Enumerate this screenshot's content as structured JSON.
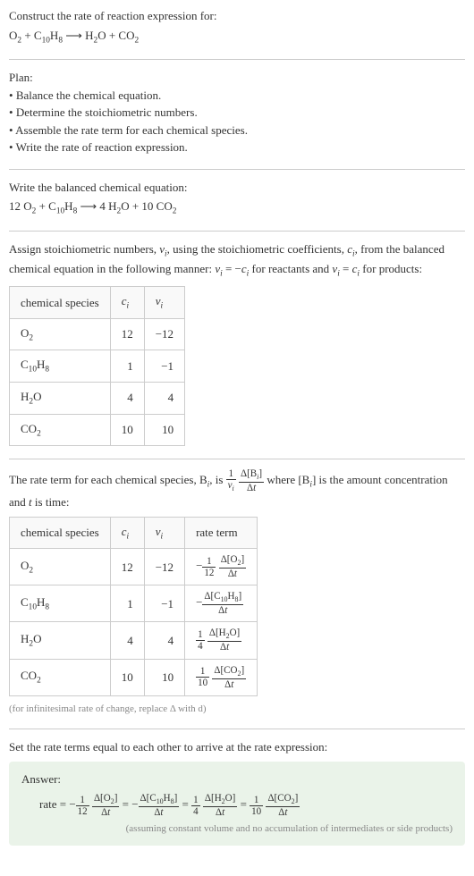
{
  "intro": {
    "title": "Construct the rate of reaction expression for:",
    "equation_html": "O<span class='sub'>2</span> + C<span class='sub'>10</span>H<span class='sub'>8</span> ⟶ H<span class='sub'>2</span>O + CO<span class='sub'>2</span>"
  },
  "plan": {
    "title": "Plan:",
    "items": [
      "Balance the chemical equation.",
      "Determine the stoichiometric numbers.",
      "Assemble the rate term for each chemical species.",
      "Write the rate of reaction expression."
    ]
  },
  "balanced": {
    "title": "Write the balanced chemical equation:",
    "equation_html": "12 O<span class='sub'>2</span> + C<span class='sub'>10</span>H<span class='sub'>8</span> ⟶ 4 H<span class='sub'>2</span>O + 10 CO<span class='sub'>2</span>"
  },
  "stoich_intro_html": "Assign stoichiometric numbers, <span class='ital'>ν<span class='sub'>i</span></span>, using the stoichiometric coefficients, <span class='ital'>c<span class='sub'>i</span></span>, from the balanced chemical equation in the following manner: <span class='ital'>ν<span class='sub'>i</span></span> = −<span class='ital'>c<span class='sub'>i</span></span> for reactants and <span class='ital'>ν<span class='sub'>i</span></span> = <span class='ital'>c<span class='sub'>i</span></span> for products:",
  "table1": {
    "headers": {
      "species": "chemical species",
      "ci_html": "<span class='ital'>c<span class='sub'>i</span></span>",
      "vi_html": "<span class='ital'>ν<span class='sub'>i</span></span>"
    },
    "rows": [
      {
        "species_html": "O<span class='sub'>2</span>",
        "ci": "12",
        "vi": "−12"
      },
      {
        "species_html": "C<span class='sub'>10</span>H<span class='sub'>8</span>",
        "ci": "1",
        "vi": "−1"
      },
      {
        "species_html": "H<span class='sub'>2</span>O",
        "ci": "4",
        "vi": "4"
      },
      {
        "species_html": "CO<span class='sub'>2</span>",
        "ci": "10",
        "vi": "10"
      }
    ]
  },
  "rate_term_intro_html": "The rate term for each chemical species, B<span class='sub'><span class='ital'>i</span></span>, is <span class='frac'><span class='num'>1</span><span class='den'><span class='ital'>ν<span class='sub'>i</span></span></span></span> <span class='frac'><span class='num'>Δ[B<span class='sub'><span class='ital'>i</span></span>]</span><span class='den'>Δ<span class='ital'>t</span></span></span> where [B<span class='sub'><span class='ital'>i</span></span>] is the amount concentration and <span class='ital'>t</span> is time:",
  "table2": {
    "headers": {
      "species": "chemical species",
      "ci_html": "<span class='ital'>c<span class='sub'>i</span></span>",
      "vi_html": "<span class='ital'>ν<span class='sub'>i</span></span>",
      "rate": "rate term"
    },
    "rows": [
      {
        "species_html": "O<span class='sub'>2</span>",
        "ci": "12",
        "vi": "−12",
        "rate_html": "−<span class='frac'><span class='num'>1</span><span class='den'>12</span></span> <span class='frac'><span class='num'>Δ[O<span class='sub'>2</span>]</span><span class='den'>Δ<span class='ital'>t</span></span></span>"
      },
      {
        "species_html": "C<span class='sub'>10</span>H<span class='sub'>8</span>",
        "ci": "1",
        "vi": "−1",
        "rate_html": "−<span class='frac'><span class='num'>Δ[C<span class='sub'>10</span>H<span class='sub'>8</span>]</span><span class='den'>Δ<span class='ital'>t</span></span></span>"
      },
      {
        "species_html": "H<span class='sub'>2</span>O",
        "ci": "4",
        "vi": "4",
        "rate_html": "<span class='frac'><span class='num'>1</span><span class='den'>4</span></span> <span class='frac'><span class='num'>Δ[H<span class='sub'>2</span>O]</span><span class='den'>Δ<span class='ital'>t</span></span></span>"
      },
      {
        "species_html": "CO<span class='sub'>2</span>",
        "ci": "10",
        "vi": "10",
        "rate_html": "<span class='frac'><span class='num'>1</span><span class='den'>10</span></span> <span class='frac'><span class='num'>Δ[CO<span class='sub'>2</span>]</span><span class='den'>Δ<span class='ital'>t</span></span></span>"
      }
    ]
  },
  "infinitesimal_note": "(for infinitesimal rate of change, replace Δ with d)",
  "set_equal": "Set the rate terms equal to each other to arrive at the rate expression:",
  "answer": {
    "title": "Answer:",
    "eq_html": "rate = −<span class='frac'><span class='num'>1</span><span class='den'>12</span></span> <span class='frac'><span class='num'>Δ[O<span class='sub'>2</span>]</span><span class='den'>Δ<span class='ital'>t</span></span></span> = −<span class='frac'><span class='num'>Δ[C<span class='sub'>10</span>H<span class='sub'>8</span>]</span><span class='den'>Δ<span class='ital'>t</span></span></span> = <span class='frac'><span class='num'>1</span><span class='den'>4</span></span> <span class='frac'><span class='num'>Δ[H<span class='sub'>2</span>O]</span><span class='den'>Δ<span class='ital'>t</span></span></span> = <span class='frac'><span class='num'>1</span><span class='den'>10</span></span> <span class='frac'><span class='num'>Δ[CO<span class='sub'>2</span>]</span><span class='den'>Δ<span class='ital'>t</span></span></span>",
    "note": "(assuming constant volume and no accumulation of intermediates or side products)"
  },
  "chart_data": {
    "type": "table",
    "title": "Stoichiometric and rate data for O2 + C10H8 → H2O + CO2 combustion",
    "species": [
      "O2",
      "C10H8",
      "H2O",
      "CO2"
    ],
    "c_i": [
      12,
      1,
      4,
      10
    ],
    "nu_i": [
      -12,
      -1,
      4,
      10
    ],
    "rate_terms": [
      "-(1/12) d[O2]/dt",
      "-d[C10H8]/dt",
      "(1/4) d[H2O]/dt",
      "(1/10) d[CO2]/dt"
    ]
  }
}
